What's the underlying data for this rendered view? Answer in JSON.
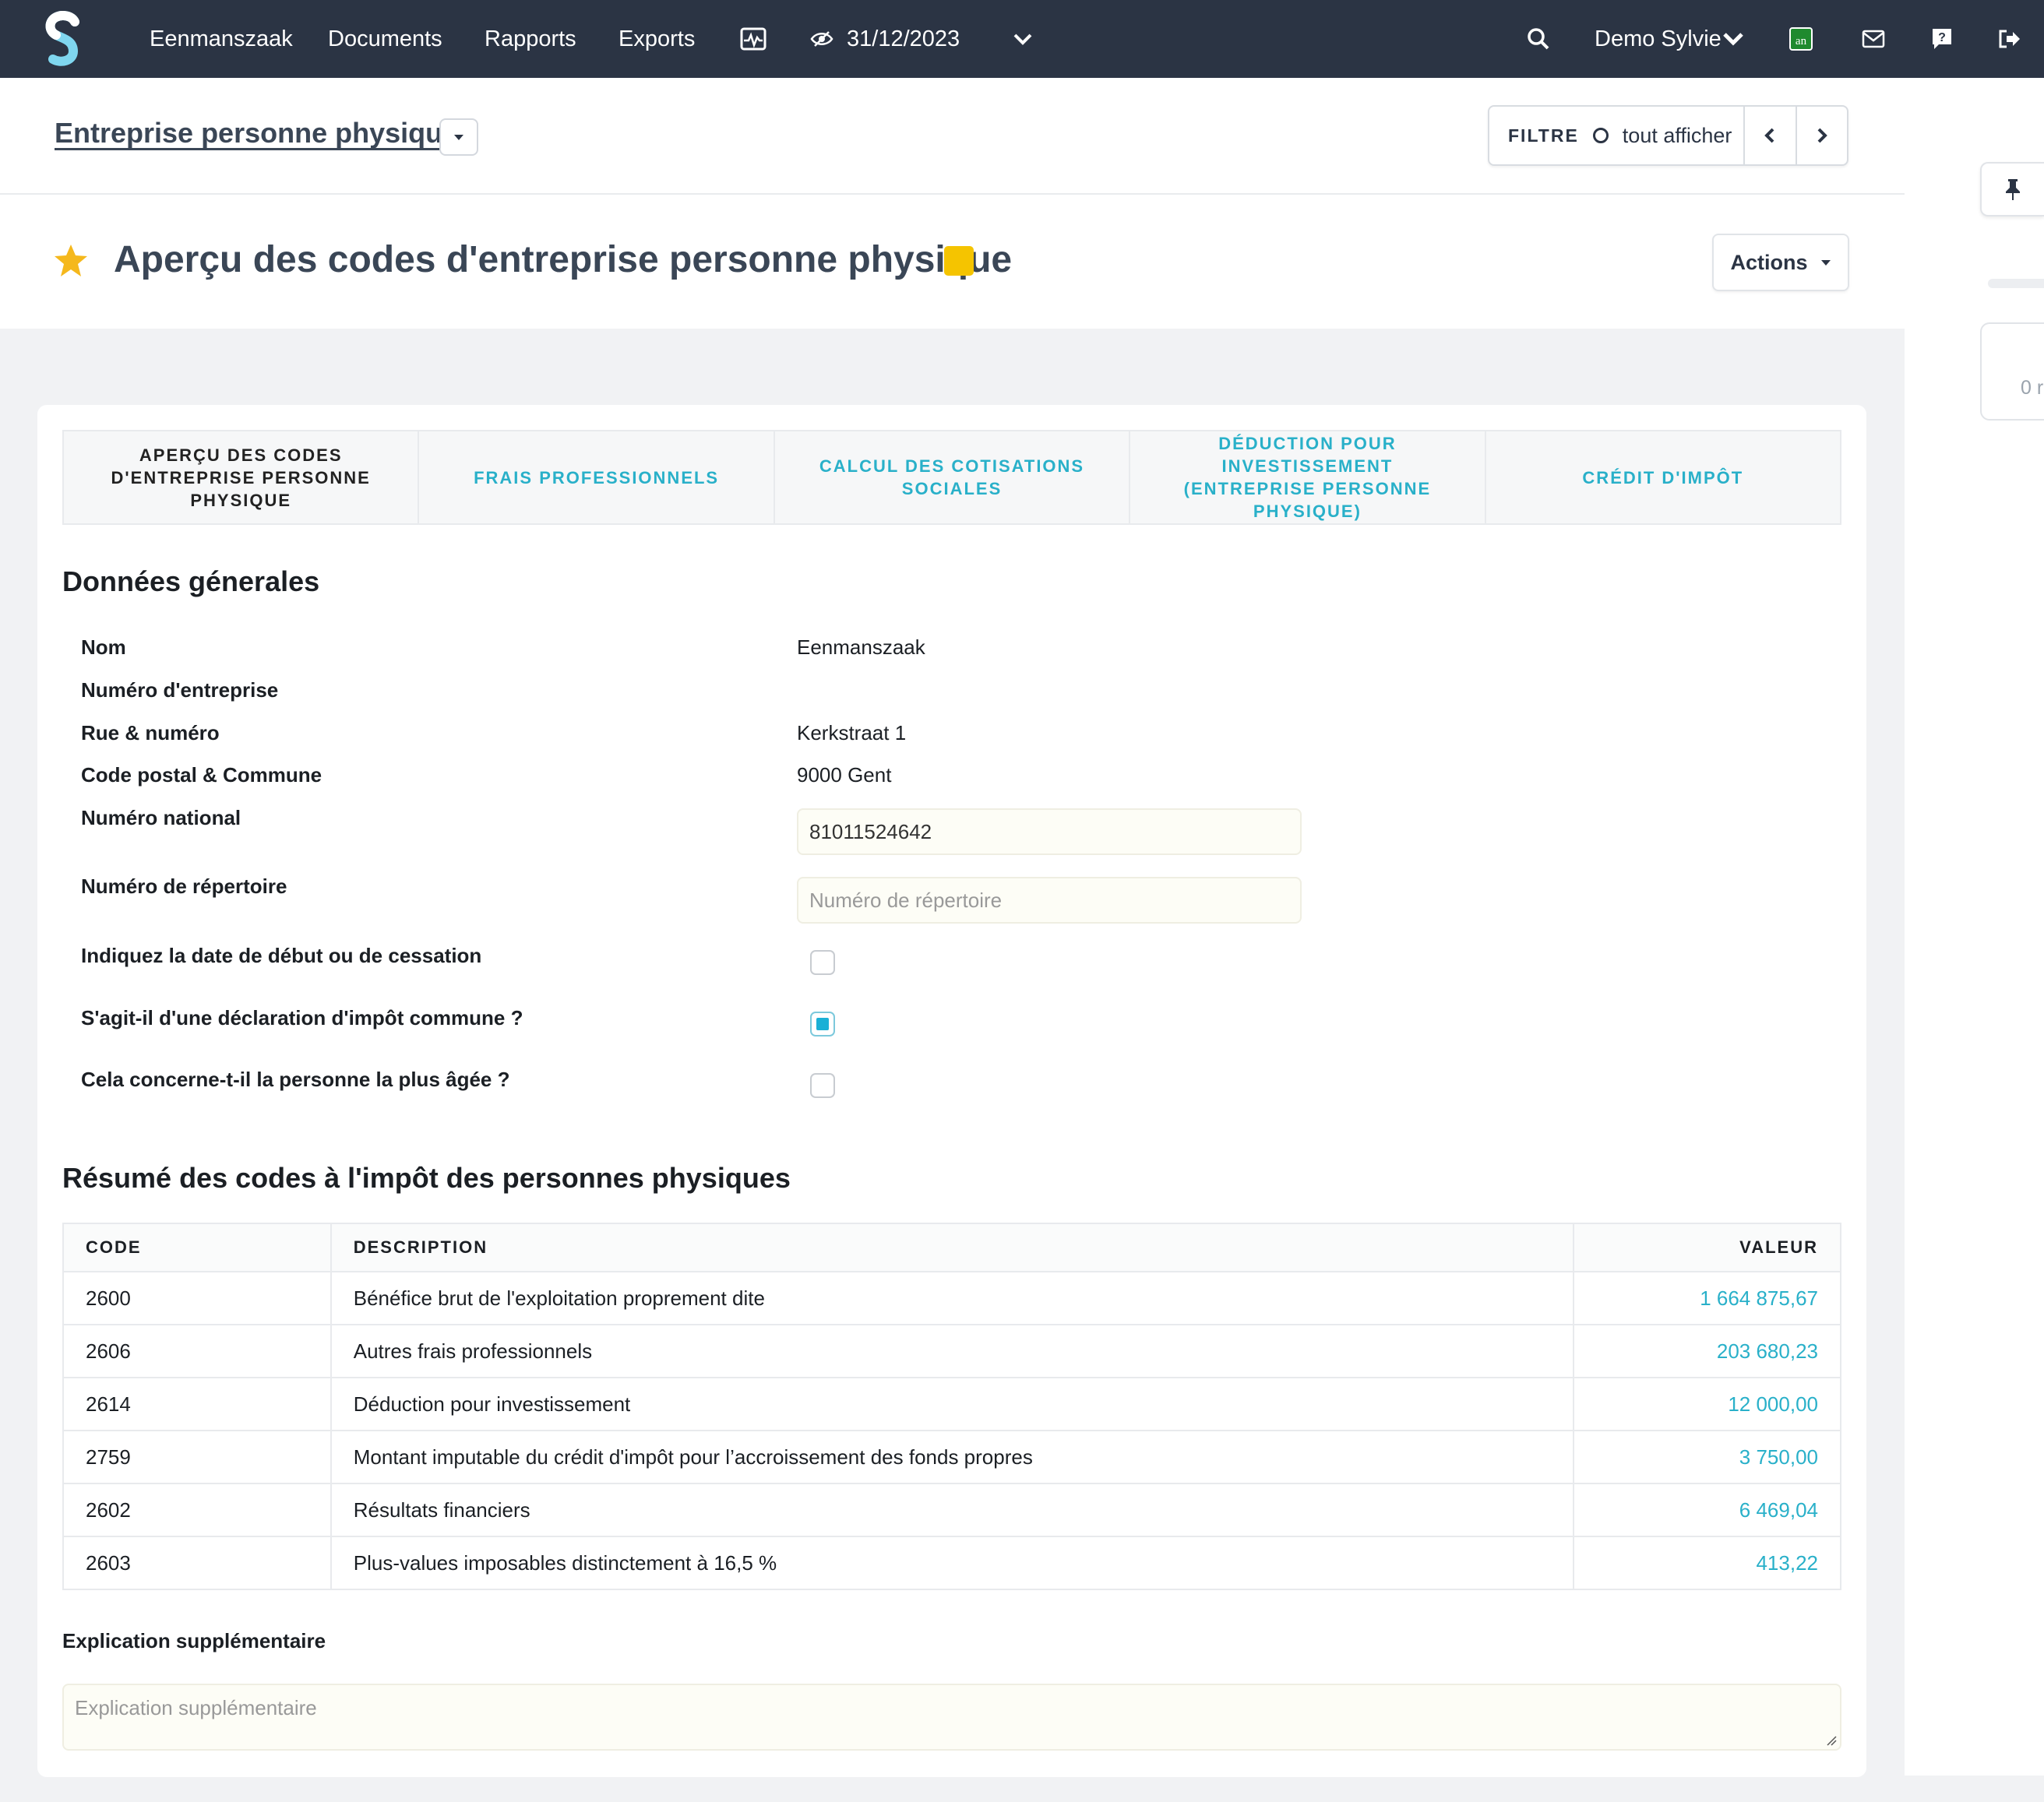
{
  "nav": {
    "items": [
      "Eenmanszaak",
      "Documents",
      "Rapports",
      "Exports"
    ],
    "date": "31/12/2023",
    "user": "Demo Sylvie",
    "badge": "an"
  },
  "header": {
    "breadcrumb": "Entreprise personne physique",
    "filter_label": "FILTRE",
    "filter_value": "tout afficher"
  },
  "title": {
    "text": "Aperçu des codes d'entreprise personne physique",
    "actions": "Actions",
    "tag_color": "#f5c400"
  },
  "sidepanel": {
    "card_text": "0 r"
  },
  "tabs": [
    "APERÇU DES CODES D'ENTREPRISE PERSONNE PHYSIQUE",
    "FRAIS PROFESSIONNELS",
    "CALCUL DES COTISATIONS SOCIALES",
    "DÉDUCTION POUR INVESTISSEMENT (ENTREPRISE PERSONNE PHYSIQUE)",
    "CRÉDIT D'IMPÔT"
  ],
  "general": {
    "title": "Données génerales",
    "nom_label": "Nom",
    "nom_value": "Eenmanszaak",
    "numero_entreprise_label": "Numéro d'entreprise",
    "rue_label": "Rue & numéro",
    "rue_value": "Kerkstraat 1",
    "code_postal_label": "Code postal & Commune",
    "code_postal_value": "9000 Gent",
    "numero_national_label": "Numéro national",
    "numero_national_value": "81011524642",
    "repertoire_label": "Numéro de répertoire",
    "repertoire_placeholder": "Numéro de répertoire",
    "date_debut_label": "Indiquez la date de début ou de cessation",
    "date_debut_checked": false,
    "commune_label": "S'agit-il d'une déclaration d'impôt commune ?",
    "commune_checked": true,
    "plus_agee_label": "Cela concerne-t-il la personne la plus âgée ?",
    "plus_agee_checked": false
  },
  "summary": {
    "title": "Résumé des codes à l'impôt des personnes physiques",
    "headers": {
      "code": "CODE",
      "description": "DESCRIPTION",
      "value": "VALEUR"
    },
    "rows": [
      {
        "code": "2600",
        "description": "Bénéfice brut de l'exploitation proprement dite",
        "value": "1 664 875,67"
      },
      {
        "code": "2606",
        "description": "Autres frais professionnels",
        "value": "203 680,23"
      },
      {
        "code": "2614",
        "description": "Déduction pour investissement",
        "value": "12 000,00"
      },
      {
        "code": "2759",
        "description": "Montant imputable du crédit d'impôt pour l’accroissement des fonds propres",
        "value": "3 750,00"
      },
      {
        "code": "2602",
        "description": "Résultats financiers",
        "value": "6 469,04"
      },
      {
        "code": "2603",
        "description": "Plus-values imposables distinctement à 16,5 %",
        "value": "413,22"
      }
    ]
  },
  "explanation": {
    "label": "Explication supplémentaire",
    "placeholder": "Explication supplémentaire"
  },
  "colors": {
    "navbar": "#2b3444",
    "accent": "#29b0c9",
    "star": "#f5b81c"
  }
}
